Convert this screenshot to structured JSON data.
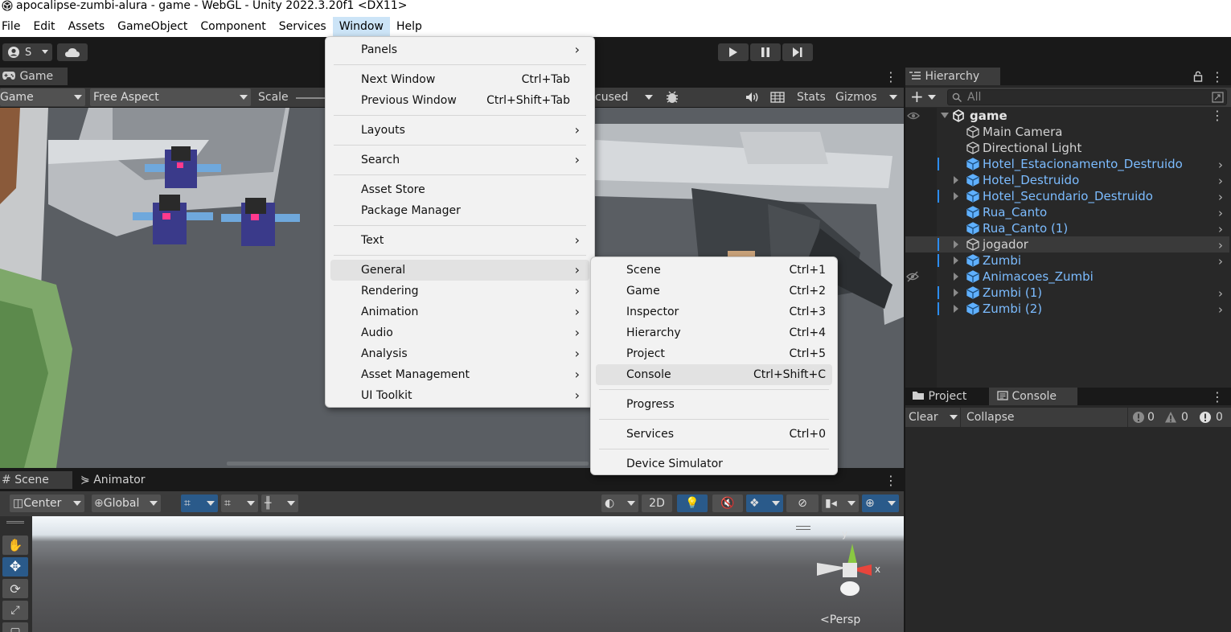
{
  "window": {
    "title": "apocalipse-zumbi-alura - game - WebGL - Unity 2022.3.20f1 <DX11>"
  },
  "menubar": [
    "File",
    "Edit",
    "Assets",
    "GameObject",
    "Component",
    "Services",
    "Window",
    "Help"
  ],
  "toolbar": {
    "account_label": "S"
  },
  "game_panel": {
    "tab": "Game",
    "display_dropdown": "Game",
    "aspect_dropdown": "Free Aspect",
    "scale_label": "Scale",
    "focused_fragment": "cused",
    "stats": "Stats",
    "gizmos": "Gizmos"
  },
  "window_menu": {
    "items": [
      {
        "label": "Panels",
        "submenu": true
      },
      {
        "label": "Next Window",
        "shortcut": "Ctrl+Tab"
      },
      {
        "label": "Previous Window",
        "shortcut": "Ctrl+Shift+Tab"
      },
      {
        "label": "Layouts",
        "submenu": true
      },
      {
        "label": "Search",
        "submenu": true
      },
      {
        "label": "Asset Store"
      },
      {
        "label": "Package Manager"
      },
      {
        "label": "Text",
        "submenu": true
      },
      {
        "label": "General",
        "submenu": true,
        "highlighted": true
      },
      {
        "label": "Rendering",
        "submenu": true
      },
      {
        "label": "Animation",
        "submenu": true
      },
      {
        "label": "Audio",
        "submenu": true
      },
      {
        "label": "Analysis",
        "submenu": true
      },
      {
        "label": "Asset Management",
        "submenu": true
      },
      {
        "label": "UI Toolkit",
        "submenu": true
      }
    ]
  },
  "general_submenu": {
    "items": [
      {
        "label": "Scene",
        "shortcut": "Ctrl+1"
      },
      {
        "label": "Game",
        "shortcut": "Ctrl+2"
      },
      {
        "label": "Inspector",
        "shortcut": "Ctrl+3"
      },
      {
        "label": "Hierarchy",
        "shortcut": "Ctrl+4"
      },
      {
        "label": "Project",
        "shortcut": "Ctrl+5"
      },
      {
        "label": "Console",
        "shortcut": "Ctrl+Shift+C",
        "highlighted": true
      },
      {
        "label": "Progress"
      },
      {
        "label": "Services",
        "shortcut": "Ctrl+0"
      },
      {
        "label": "Device Simulator"
      }
    ]
  },
  "hierarchy": {
    "tab": "Hierarchy",
    "search_placeholder": "All",
    "scene": "game",
    "items": [
      {
        "name": "Main Camera",
        "type": "normal"
      },
      {
        "name": "Directional Light",
        "type": "normal"
      },
      {
        "name": "Hotel_Estacionamento_Destruido",
        "type": "prefab"
      },
      {
        "name": "Hotel_Destruido",
        "type": "prefab"
      },
      {
        "name": "Hotel_Secundario_Destruido",
        "type": "prefab"
      },
      {
        "name": "Rua_Canto",
        "type": "prefab"
      },
      {
        "name": "Rua_Canto (1)",
        "type": "prefab"
      },
      {
        "name": "jogador",
        "type": "normal"
      },
      {
        "name": "Zumbi",
        "type": "prefab"
      },
      {
        "name": "Animacoes_Zumbi",
        "type": "prefab"
      },
      {
        "name": "Zumbi (1)",
        "type": "prefab"
      },
      {
        "name": "Zumbi (2)",
        "type": "prefab"
      }
    ]
  },
  "console_panel": {
    "tabs": [
      "Project",
      "Console"
    ],
    "clear": "Clear",
    "collapse": "Collapse",
    "log_count": "0",
    "warning_count": "0",
    "error_count": "0"
  },
  "scene_panel": {
    "tabs": [
      "Scene",
      "Animator"
    ],
    "pivot": "Center",
    "space": "Global",
    "mode_2d": "2D",
    "projection": "Persp",
    "axis_y": "y",
    "axis_x": "x"
  },
  "colors": {
    "prefab_text": "#7cbcff",
    "selection_bar": "#2b8cf0",
    "menu_bg": "#f2f2f2",
    "menu_highlight": "#e2e2e2"
  }
}
